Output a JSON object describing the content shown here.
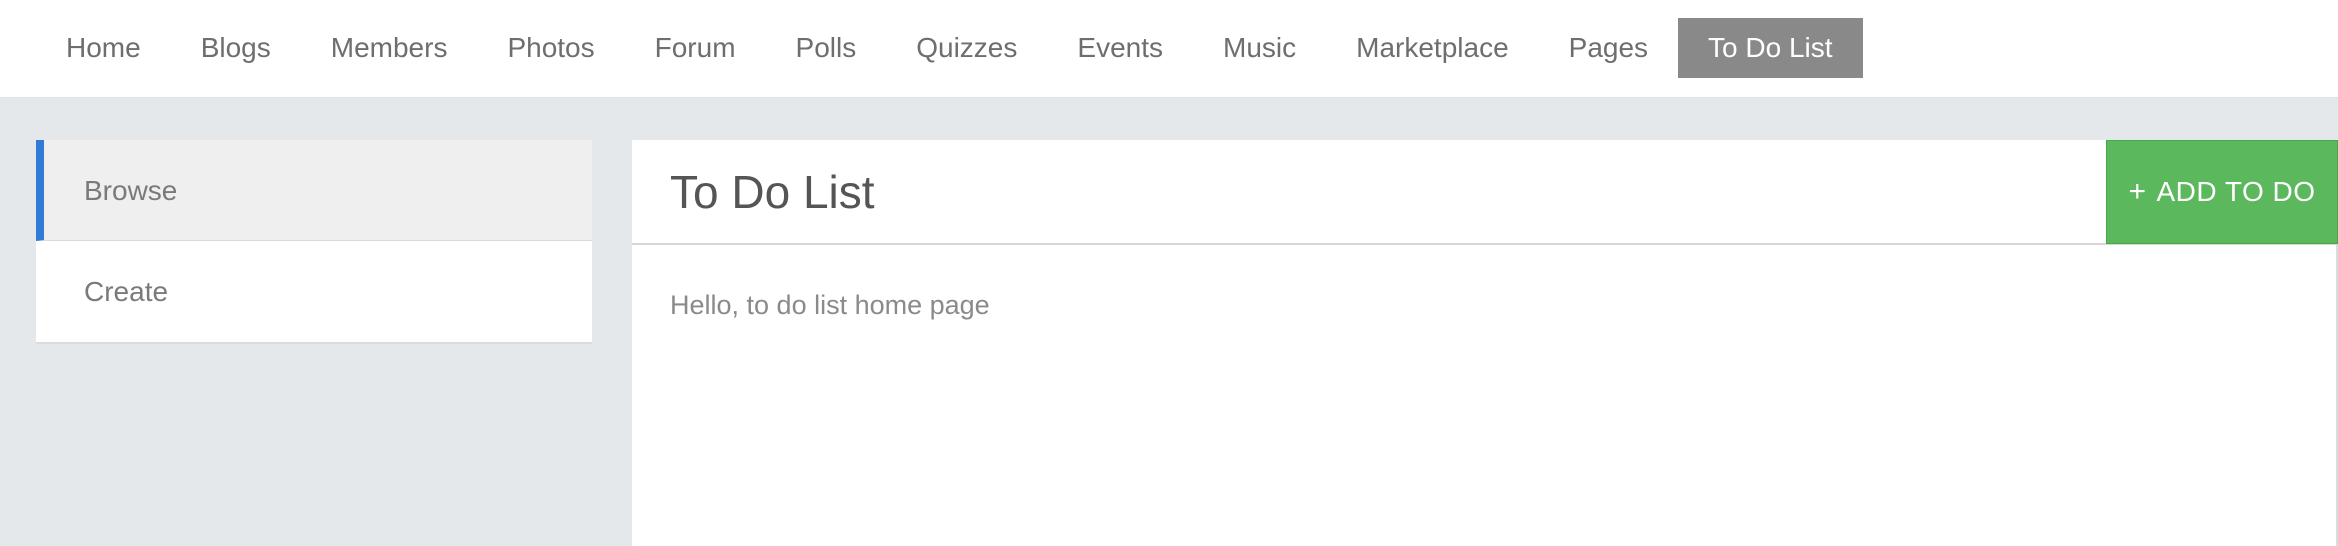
{
  "nav": {
    "items": [
      {
        "label": "Home"
      },
      {
        "label": "Blogs"
      },
      {
        "label": "Members"
      },
      {
        "label": "Photos"
      },
      {
        "label": "Forum"
      },
      {
        "label": "Polls"
      },
      {
        "label": "Quizzes"
      },
      {
        "label": "Events"
      },
      {
        "label": "Music"
      },
      {
        "label": "Marketplace"
      },
      {
        "label": "Pages"
      },
      {
        "label": "To Do List"
      }
    ],
    "active_index": 11
  },
  "sidebar": {
    "items": [
      {
        "label": "Browse"
      },
      {
        "label": "Create"
      }
    ],
    "active_index": 0
  },
  "main": {
    "title": "To Do List",
    "add_button": {
      "icon": "plus-icon",
      "label": "ADD TO DO"
    },
    "body_text": "Hello, to do list home page"
  },
  "colors": {
    "accent_blue": "#2f7bd6",
    "add_button_green": "#5cb85c",
    "active_nav_bg": "#898989",
    "page_bg": "#e4e8eb"
  }
}
